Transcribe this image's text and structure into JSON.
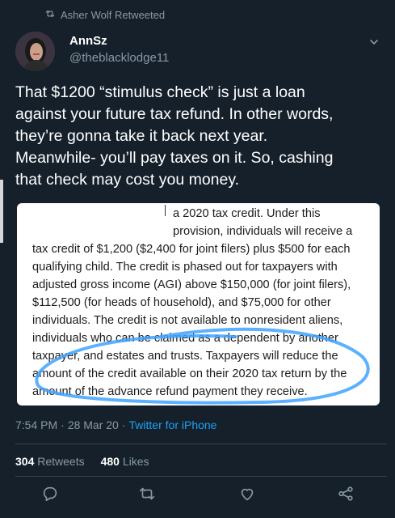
{
  "retweet_banner": {
    "text": "Asher Wolf Retweeted",
    "icon": "retweet-icon"
  },
  "author": {
    "name": "AnnSz",
    "handle": "@theblacklodge11"
  },
  "tweet": {
    "lines": [
      "That $1200 “stimulus check” is just a loan",
      "against your future tax refund. In other words,",
      "they’re gonna take it back next year.",
      "Meanwhile- you’ll pay taxes on it. So, cashing",
      "that check may cost you money."
    ]
  },
  "image": {
    "lines": [
      "a 2020 tax credit. Under this",
      "provision, individuals will receive a",
      "tax credit of $1,200 ($2,400 for joint filers) plus $500 for each",
      "qualifying child. The credit is phased out for taxpayers with",
      "adjusted gross income (AGI) above $150,000 (for joint filers),",
      "$112,500 (for heads of household), and $75,000 for other",
      "individuals. The credit is not available to nonresident aliens,",
      "individuals who can be claimed as a dependent by another",
      "taxpayer, and estates and trusts. Taxpayers will reduce the",
      "amount of the credit available on their 2020 tax return by the",
      "amount of the advance refund payment they receive."
    ],
    "highlight_color": "#3ea3ff"
  },
  "meta": {
    "time": "7:54 PM",
    "sep1": "·",
    "date": "28 Mar 20",
    "sep2": "·",
    "source": "Twitter for iPhone"
  },
  "stats": {
    "retweets_count": "304",
    "retweets_label": "Retweets",
    "likes_count": "480",
    "likes_label": "Likes"
  },
  "actions": [
    "reply-icon",
    "retweet-icon",
    "like-icon",
    "share-icon"
  ],
  "colors": {
    "background": "#15202b",
    "muted": "#8899a6",
    "link": "#1da1f2",
    "divider": "#38444d"
  }
}
